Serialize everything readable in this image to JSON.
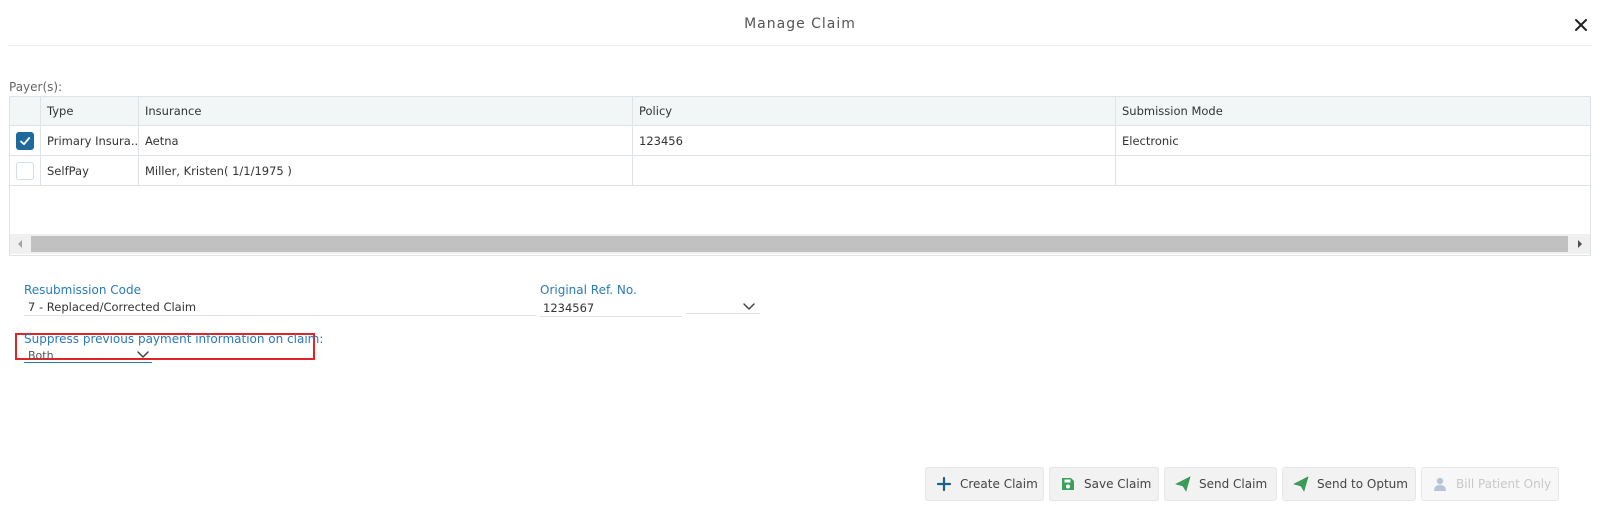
{
  "window": {
    "title": "Manage Claim",
    "close_icon": "close-icon"
  },
  "payers": {
    "label": "Payer(s):",
    "columns": [
      "Type",
      "Insurance",
      "Policy",
      "Submission Mode"
    ],
    "rows": [
      {
        "checked": true,
        "type": "Primary Insura...",
        "insurance": "Aetna",
        "policy": "123456",
        "submission_mode": "Electronic"
      },
      {
        "checked": false,
        "type": "SelfPay",
        "insurance": "Miller, Kristen( 1/1/1975 )",
        "policy": "",
        "submission_mode": ""
      }
    ]
  },
  "form": {
    "resubmission_code": {
      "label": "Resubmission Code",
      "value": "7 - Replaced/Corrected Claim"
    },
    "original_ref": {
      "label": "Original Ref. No.",
      "value": "1234567"
    },
    "suppress": {
      "label": "Suppress previous payment information on claim:",
      "value": "Both"
    }
  },
  "actions": {
    "create_claim": "Create Claim",
    "save_claim": "Save Claim",
    "send_claim": "Send Claim",
    "send_to_optum": "Send to Optum",
    "bill_patient_only": "Bill Patient Only"
  },
  "colors": {
    "accent": "#1f6a9c",
    "label_blue": "#2a7ab8",
    "send_green": "#3aa05a",
    "highlight_red": "#e32424"
  }
}
